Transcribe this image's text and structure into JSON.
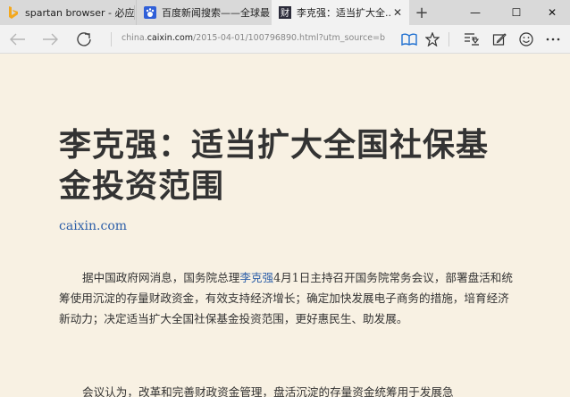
{
  "tabs": [
    {
      "title": "spartan browser - 必应 资讯",
      "icon": "bing-icon"
    },
    {
      "title": "百度新闻搜索——全球最...",
      "icon": "baidu-icon"
    },
    {
      "title": "李克强：适当扩大全...",
      "icon": "caixin-icon",
      "active": true
    }
  ],
  "window": {
    "new_tab": "+",
    "minimize": "—",
    "maximize": "☐",
    "close": "✕"
  },
  "address": {
    "prefix": "china.",
    "domain": "caixin.com",
    "path": "/2015-04-01/100796890.html?utm_source=b"
  },
  "article": {
    "title": "李克强：适当扩大全国社保基金投资范围",
    "source": "caixin.com",
    "p1_before": "据中国政府网消息，国务院总理",
    "p1_link": "李克强",
    "p1_after": "4月1日主持召开国务院常务会议，部署盘活和统筹使用沉淀的存量财政资金，有效支持经济增长；确定加快发展电子商务的措施，培育经济新动力；决定适当扩大全国社保基金投资范围，更好惠民生、助发展。",
    "p2": "会议认为，改革和完善财政资金管理，盘活沉淀的存量资金统筹用于发展急"
  },
  "colors": {
    "link": "#2d5fa8",
    "page_bg": "#f8f1e3",
    "text": "#333333"
  }
}
